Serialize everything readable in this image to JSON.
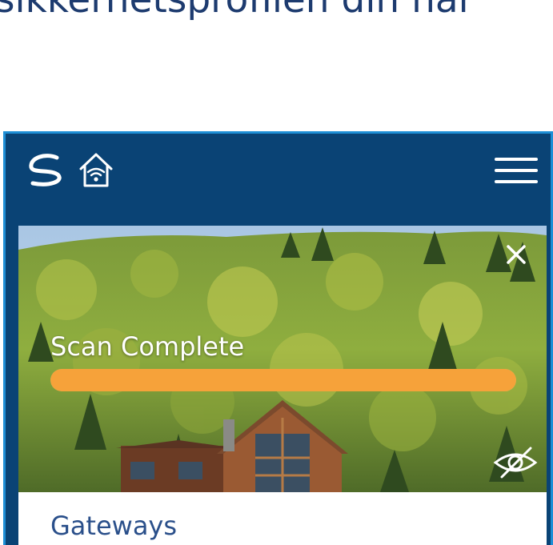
{
  "page": {
    "heading": "sikkerhetsprofilen din når"
  },
  "app": {
    "colors": {
      "header_bg": "#0a4375",
      "frame_border": "#1e8fd6",
      "progress": "#f6a23a",
      "section_title": "#2a4f8a"
    },
    "header": {
      "logo_icon": "swirl-logo-icon",
      "home_icon": "home-wifi-icon",
      "menu_icon": "hamburger-menu-icon"
    },
    "scan_card": {
      "status": "Scan Complete",
      "progress": 1.0,
      "close_icon": "close-icon",
      "visibility_icon": "eye-slash-icon"
    },
    "section": {
      "title": "Gateways"
    }
  }
}
